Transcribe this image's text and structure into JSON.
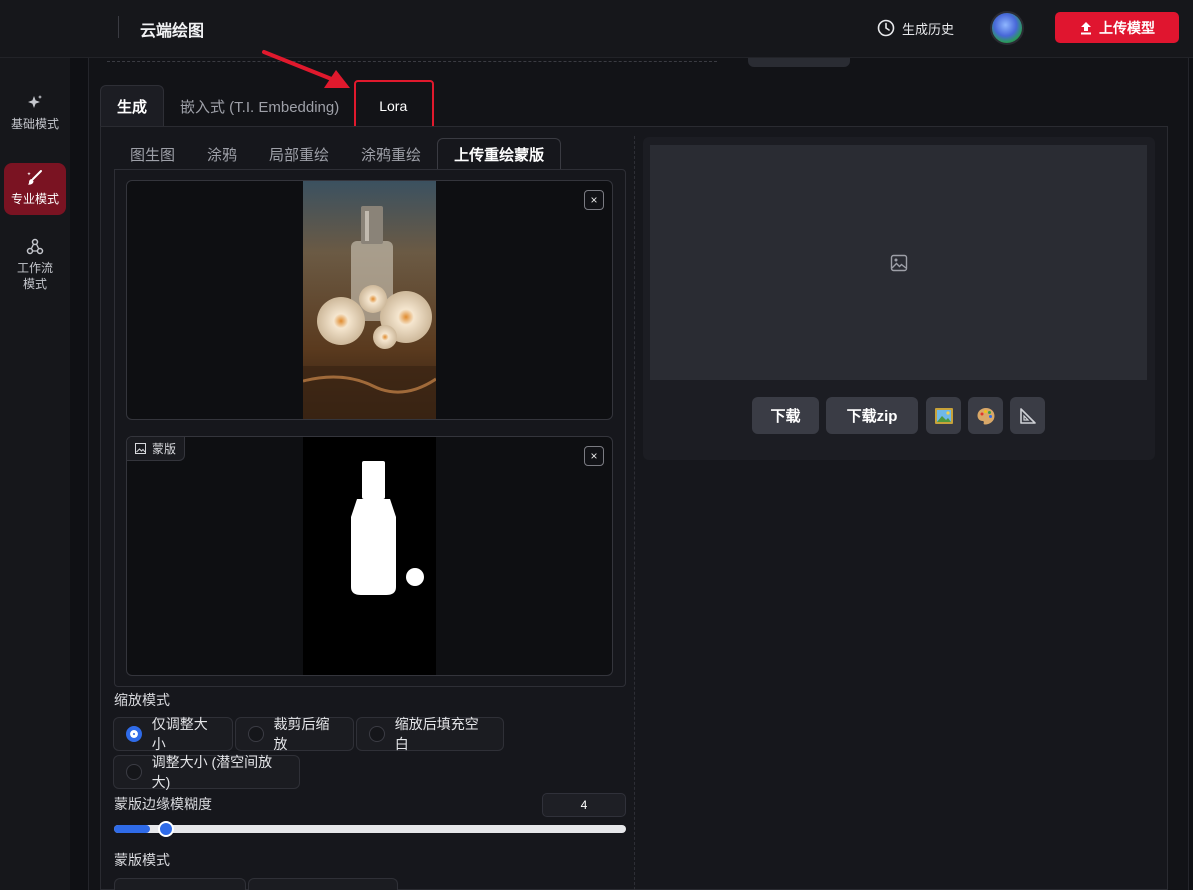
{
  "header": {
    "title": "云端绘图",
    "history_label": "生成历史",
    "upload_label": "上传模型"
  },
  "sidebar": {
    "items": [
      {
        "label": "基础模式",
        "icon": "sparkle-icon"
      },
      {
        "label": "专业模式",
        "icon": "brush-icon",
        "active": true
      },
      {
        "label": "工作流\n模式",
        "icon": "workflow-icon"
      }
    ]
  },
  "tabs_main": {
    "items": [
      "生成",
      "嵌入式 (T.I. Embedding)",
      "Lora"
    ],
    "active": "生成",
    "highlighted": "Lora"
  },
  "sub_tabs": {
    "items": [
      "图生图",
      "涂鸦",
      "局部重绘",
      "涂鸦重绘",
      "上传重绘蒙版"
    ],
    "active": "上传重绘蒙版"
  },
  "image_input": {
    "close_symbol": "×"
  },
  "mask_input": {
    "label": "蒙版",
    "close_symbol": "×"
  },
  "resize_mode": {
    "label": "缩放模式",
    "options": [
      "仅调整大小",
      "裁剪后缩放",
      "缩放后填充空白",
      "调整大小 (潜空间放大)"
    ],
    "selected": "仅调整大小"
  },
  "mask_blur": {
    "label": "蒙版边缘模糊度",
    "value": "4",
    "min": 0,
    "max": 64,
    "level": 4
  },
  "mask_mode": {
    "label": "蒙版模式"
  },
  "output": {
    "download_label": "下载",
    "download_zip_label": "下载zip"
  },
  "colors": {
    "accent_red": "#e0152f",
    "accent_blue": "#2f6be8",
    "active_sidebar": "#7a1322"
  }
}
